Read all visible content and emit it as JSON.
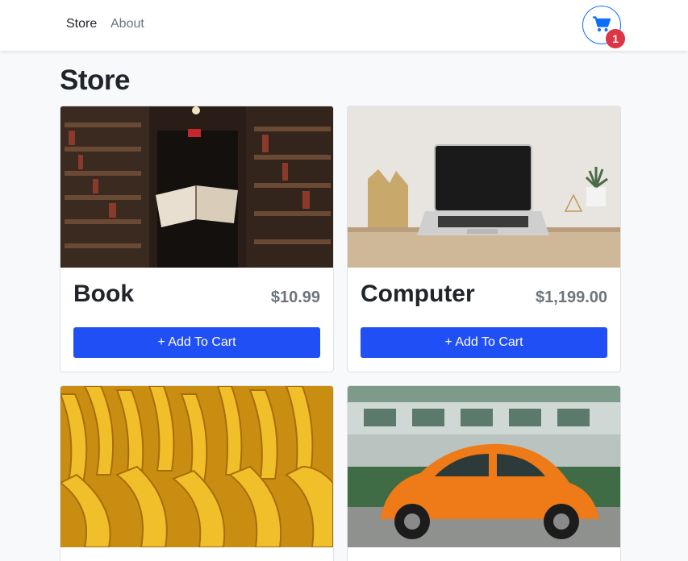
{
  "nav": {
    "links": [
      {
        "label": "Store"
      },
      {
        "label": "About"
      }
    ],
    "cart": {
      "icon": "cart-icon",
      "count": "1",
      "accent": "#0d6efd",
      "badge_color": "#dc3545"
    }
  },
  "page": {
    "title": "Store"
  },
  "products": [
    {
      "name": "Book",
      "price": "$10.99",
      "button_label": "+ Add To Cart",
      "image": "book-image"
    },
    {
      "name": "Computer",
      "price": "$1,199.00",
      "button_label": "+ Add To Cart",
      "image": "laptop-image"
    },
    {
      "name": "",
      "price": "",
      "button_label": "",
      "image": "banana-image"
    },
    {
      "name": "",
      "price": "",
      "button_label": "",
      "image": "car-image"
    }
  ],
  "colors": {
    "button": "#1f4ff5",
    "price": "#6c757d",
    "background": "#f8f9fa"
  }
}
